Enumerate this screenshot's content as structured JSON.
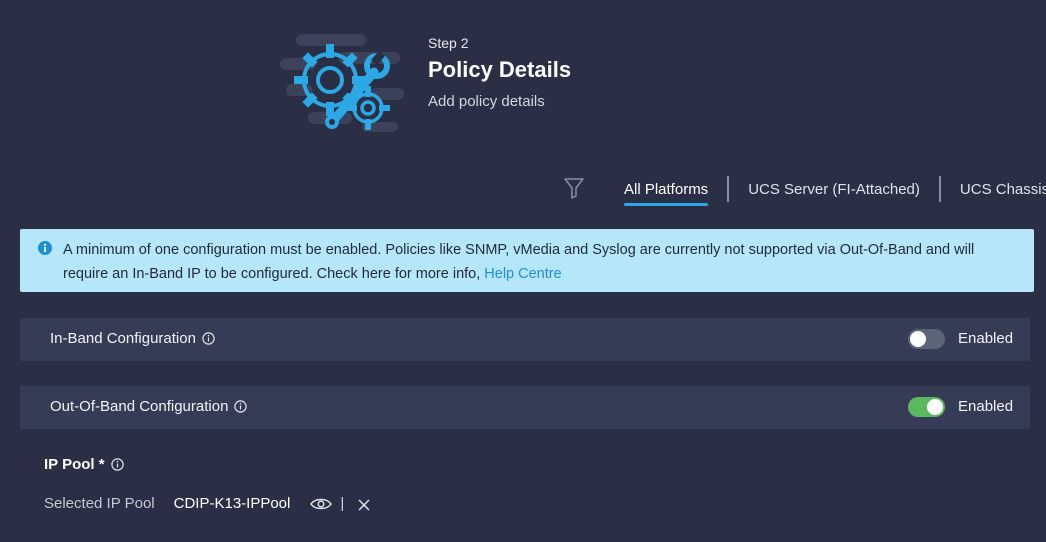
{
  "header": {
    "step_label": "Step 2",
    "title": "Policy Details",
    "subtitle": "Add policy details",
    "icon": "gear-wrench-icon"
  },
  "platform_tabs": {
    "filter_icon": "filter-icon",
    "tabs": [
      {
        "label": "All Platforms",
        "active": true
      },
      {
        "label": "UCS Server (FI-Attached)",
        "active": false
      },
      {
        "label": "UCS Chassis",
        "active": false
      }
    ]
  },
  "banner": {
    "icon": "info-icon",
    "text": "A minimum of one configuration must be enabled. Policies like SNMP, vMedia and Syslog are currently not supported via Out-Of-Band and will require an In-Band IP to be configured. Check here for more info, ",
    "link_text": "Help Centre"
  },
  "config": {
    "inband": {
      "label": "In-Band Configuration",
      "toggle_label": "Enabled",
      "enabled": false
    },
    "outband": {
      "label": "Out-Of-Band Configuration",
      "toggle_label": "Enabled",
      "enabled": true
    }
  },
  "ip_pool": {
    "heading": "IP Pool *",
    "selected_label": "Selected IP Pool",
    "selected_value": "CDIP-K13-IPPool",
    "separator": "|"
  },
  "colors": {
    "background": "#2a2f45",
    "row_background": "#363c55",
    "banner_background": "#b6e6f9",
    "accent": "#2ba8e6",
    "toggle_on": "#5cb85c",
    "toggle_off": "#5e6478",
    "link": "#1d8fd6"
  }
}
